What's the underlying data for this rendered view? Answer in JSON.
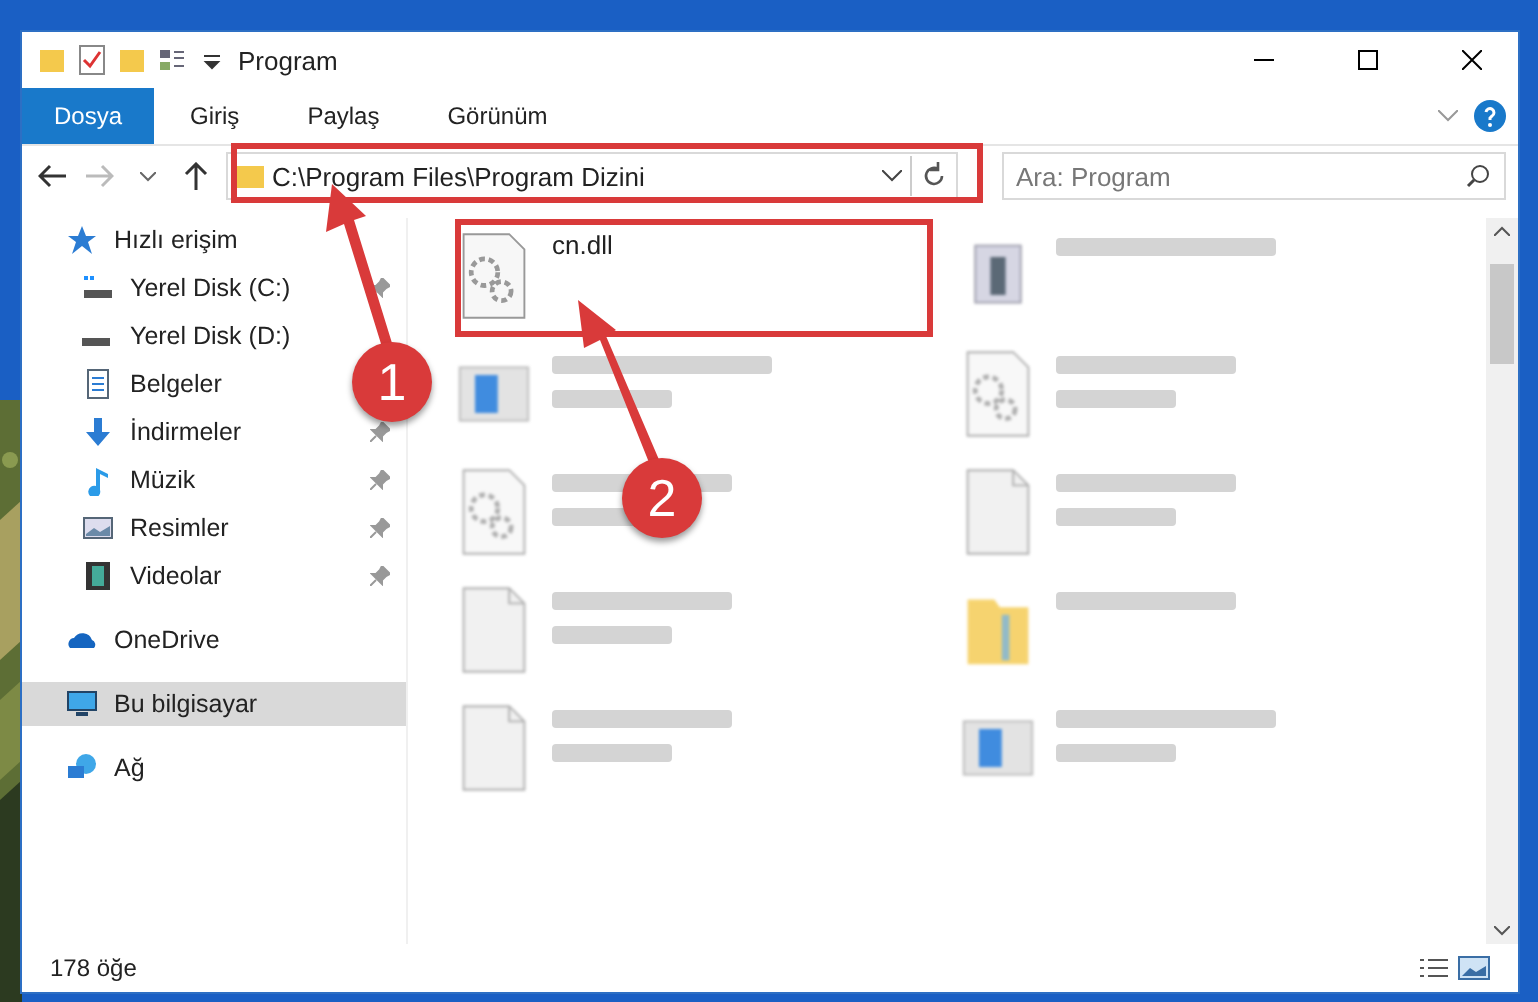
{
  "window": {
    "title": "Program"
  },
  "ribbon_tabs": [
    {
      "label": "Dosya",
      "selected": true
    },
    {
      "label": "Giriş",
      "selected": false
    },
    {
      "label": "Paylaş",
      "selected": false
    },
    {
      "label": "Görünüm",
      "selected": false
    }
  ],
  "address": {
    "path": "C:\\Program Files\\Program Dizini"
  },
  "search": {
    "placeholder": "Ara: Program"
  },
  "sidebar": {
    "items": [
      {
        "label": "Hızlı erişim",
        "kind": "star",
        "selected": false,
        "children": [
          {
            "label": "Yerel Disk (C:)",
            "kind": "diskc",
            "selected": false,
            "pinned": true
          },
          {
            "label": "Yerel Disk (D:)",
            "kind": "disk",
            "selected": false
          },
          {
            "label": "Belgeler",
            "kind": "doc",
            "selected": false
          },
          {
            "label": "İndirmeler",
            "kind": "download",
            "selected": false,
            "pinned": true
          },
          {
            "label": "Müzik",
            "kind": "music",
            "selected": false,
            "pinned": true
          },
          {
            "label": "Resimler",
            "kind": "pictures",
            "selected": false,
            "pinned": true
          },
          {
            "label": "Videolar",
            "kind": "video",
            "selected": false,
            "pinned": true
          }
        ]
      },
      {
        "label": "OneDrive",
        "kind": "cloud",
        "selected": false
      },
      {
        "label": "Bu bilgisayar",
        "kind": "pc",
        "selected": true
      },
      {
        "label": "Ağ",
        "kind": "network",
        "selected": false
      }
    ]
  },
  "files": [
    {
      "name": "cn.dll",
      "kind": "dll"
    },
    {
      "kind": "setup"
    },
    {
      "kind": "app"
    },
    {
      "kind": "dll"
    },
    {
      "kind": "dll"
    },
    {
      "kind": "blank"
    },
    {
      "kind": "blank"
    },
    {
      "kind": "folder"
    },
    {
      "kind": "blank"
    },
    {
      "kind": "app"
    }
  ],
  "status_bar": {
    "count": "178 öğe"
  },
  "annotations": [
    {
      "label": "1"
    },
    {
      "label": "2"
    }
  ]
}
